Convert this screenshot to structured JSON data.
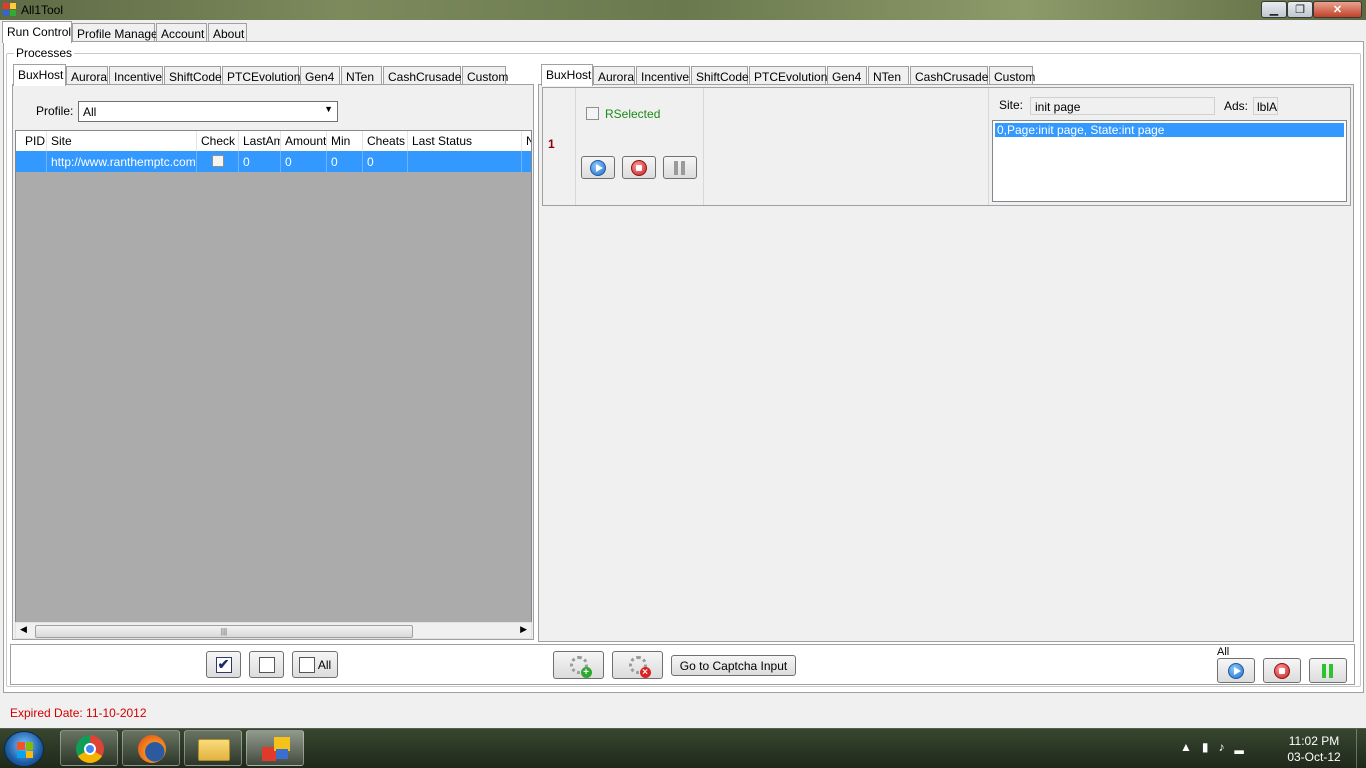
{
  "window": {
    "title": "All1Tool"
  },
  "main_tabs": [
    "Run Control",
    "Profile Manager",
    "Account",
    "About"
  ],
  "processes_label": "Processes",
  "site_tabs": [
    "BuxHost",
    "Aurora",
    "Incentive",
    "ShiftCode",
    "PTCEvolution",
    "Gen4",
    "NTen",
    "CashCrusader",
    "Custom"
  ],
  "profile": {
    "label": "Profile:",
    "value": "All"
  },
  "grid": {
    "columns": [
      "PID",
      "Site",
      "Check",
      "LastAm",
      "Amount",
      "Min",
      "Cheats",
      "Last Status",
      "N"
    ],
    "rows": [
      {
        "pid": "",
        "site": "http://www.ranthemptc.com",
        "check": "",
        "last_amount": "0",
        "amount": "0",
        "min": "0",
        "cheats": "0",
        "last_status": ""
      }
    ]
  },
  "process_card": {
    "index": "1",
    "rselected_label": "RSelected",
    "site_label": "Site:",
    "site_value": "init page",
    "ads_label": "Ads:",
    "ads_value": "lblA",
    "log": [
      "0,Page:init page, State:int page"
    ]
  },
  "bottom": {
    "all_label": "All",
    "captcha_button": "Go to Captcha Input",
    "group_label": "All"
  },
  "status": {
    "expired": "Expired Date: 11-10-2012"
  },
  "taskbar": {
    "time": "11:02 PM",
    "date": "03-Oct-12",
    "apps": [
      "chrome",
      "firefox",
      "explorer",
      "all1tool"
    ]
  },
  "colors": {
    "selection": "#3399ff",
    "expired": "#d40000",
    "rselected": "#1a8a1a",
    "index": "#8b0000"
  }
}
